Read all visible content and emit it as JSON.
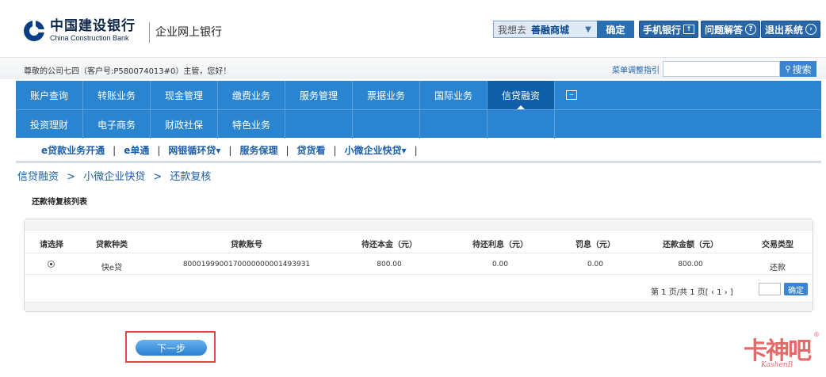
{
  "header": {
    "bank_name_cn": "中国建设银行",
    "bank_name_en": "China Construction Bank",
    "site_title": "企业网上银行",
    "goto_label": "我想去",
    "goto_value": "善融商城",
    "goto_ok": "确定",
    "buttons": [
      "手机银行",
      "问题解答",
      "退出系统"
    ]
  },
  "greet": {
    "text": "尊敬的公司七四（客户号:P580074013#0）主管，您好！",
    "menu_guide": "菜单调整指引",
    "search_button": "搜索"
  },
  "nav": {
    "row1": [
      "账户查询",
      "转账业务",
      "现金管理",
      "缴费业务",
      "服务管理",
      "票据业务",
      "国际业务",
      "信贷融资"
    ],
    "row2": [
      "投资理财",
      "电子商务",
      "财政社保",
      "特色业务"
    ],
    "active": "信贷融资"
  },
  "subnav": [
    "e贷款业务开通",
    "e单通",
    "网银循环贷▾",
    "服务保理",
    "贷货看",
    "小微企业快贷▾"
  ],
  "breadcrumb": [
    "信贷融资",
    ">",
    "小微企业快贷",
    ">",
    "还款复核"
  ],
  "section_title": "还款待复核列表",
  "table": {
    "headers": [
      "请选择",
      "贷款种类",
      "贷款账号",
      "待还本金（元）",
      "待还利息（元）",
      "罚息（元）",
      "还款金额（元）",
      "交易类型"
    ],
    "rows": [
      {
        "loan_type": "快e贷",
        "account": "8000199900170000000001493931",
        "principal": "800.00",
        "interest": "0.00",
        "penalty": "0.00",
        "amount": "800.00",
        "tx_type": "还款",
        "selected": true
      }
    ]
  },
  "pager": {
    "text": "第 1 页/共 1 页[ ‹  1   › ]",
    "button": "确定"
  },
  "next_button": "下一步",
  "watermark": {
    "text": "卡神吧",
    "sub": "KashenB",
    "reg": "®"
  },
  "colors": {
    "nav_blue": "#2b84cf",
    "nav_active": "#0f5fa8",
    "link_blue": "#1d5ea8",
    "highlight_red": "#e0464a"
  }
}
